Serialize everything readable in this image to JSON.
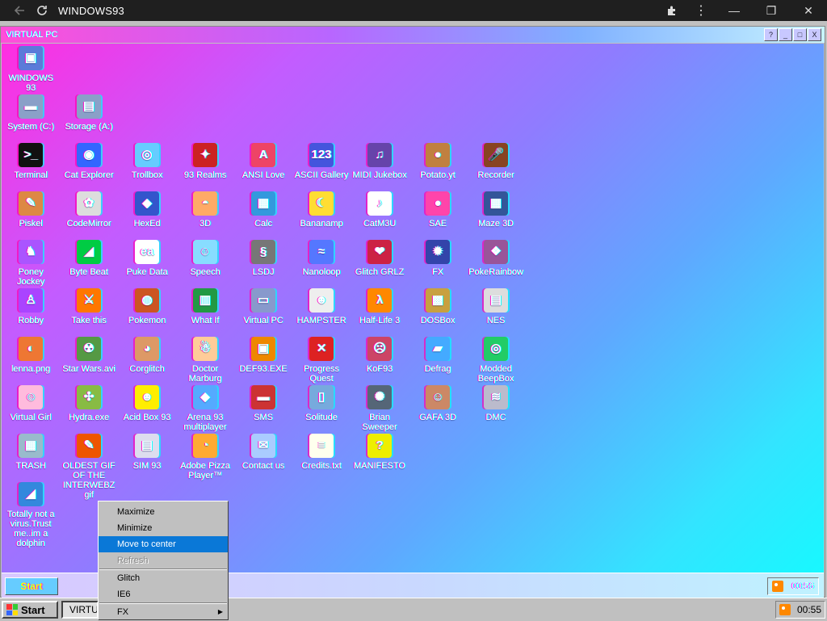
{
  "browser": {
    "title": "WINDOWS93",
    "icons": [
      "back-arrow-icon",
      "reload-icon",
      "extensions-icon",
      "menu-dots-icon",
      "minimize-icon",
      "restore-icon",
      "close-icon"
    ]
  },
  "vpc": {
    "title": "VIRTUAL PC",
    "controls": [
      "?",
      "_",
      "□",
      "X"
    ]
  },
  "desktop": {
    "icons": [
      {
        "label": "WINDOWS 93",
        "color": "#5b7bd9",
        "glyph": "▣"
      },
      {
        "label": "System (C:)",
        "color": "#8aa0c8",
        "glyph": "▬"
      },
      {
        "label": "Storage (A:)",
        "color": "#8aa0c8",
        "glyph": "▤"
      },
      {
        "label": "Terminal",
        "color": "#111111",
        "glyph": ">_"
      },
      {
        "label": "Cat Explorer",
        "color": "#3366ff",
        "glyph": "◉"
      },
      {
        "label": "Trollbox",
        "color": "#66ccff",
        "glyph": "◎"
      },
      {
        "label": "93 Realms",
        "color": "#cc2222",
        "glyph": "✦"
      },
      {
        "label": "ANSI Love",
        "color": "#ee4466",
        "glyph": "A"
      },
      {
        "label": "ASCII Gallery",
        "color": "#4455dd",
        "glyph": "123"
      },
      {
        "label": "MIDI Jukebox",
        "color": "#6644aa",
        "glyph": "♫"
      },
      {
        "label": "Potato.yt",
        "color": "#c08040",
        "glyph": "●"
      },
      {
        "label": "Recorder",
        "color": "#884422",
        "glyph": "🎤"
      },
      {
        "label": "Piskel",
        "color": "#dd8844",
        "glyph": "✎"
      },
      {
        "label": "CodeMirror",
        "color": "#dddddd",
        "glyph": "✿"
      },
      {
        "label": "HexEd",
        "color": "#3355cc",
        "glyph": "◆"
      },
      {
        "label": "3D",
        "color": "#ffaa66",
        "glyph": "◓"
      },
      {
        "label": "Calc",
        "color": "#3399dd",
        "glyph": "▦"
      },
      {
        "label": "Bananamp",
        "color": "#ffdd33",
        "glyph": "☾"
      },
      {
        "label": "CatM3U",
        "color": "#ffffff",
        "glyph": "♪"
      },
      {
        "label": "SAE",
        "color": "#ff44aa",
        "glyph": "●"
      },
      {
        "label": "Maze 3D",
        "color": "#335599",
        "glyph": "▦"
      },
      {
        "label": "Poney Jockey",
        "color": "#aa55ff",
        "glyph": "♞"
      },
      {
        "label": "Byte Beat",
        "color": "#00cc44",
        "glyph": "◢"
      },
      {
        "label": "Puke Data",
        "color": "#ffffff",
        "glyph": "ea"
      },
      {
        "label": "Speech",
        "color": "#88ddff",
        "glyph": "☺"
      },
      {
        "label": "LSDJ",
        "color": "#777777",
        "glyph": "§"
      },
      {
        "label": "Nanoloop",
        "color": "#5577ff",
        "glyph": "≈"
      },
      {
        "label": "Glitch GRLZ",
        "color": "#cc2244",
        "glyph": "❤"
      },
      {
        "label": "FX",
        "color": "#3344aa",
        "glyph": "✹"
      },
      {
        "label": "PokeRainbow",
        "color": "#995599",
        "glyph": "❖"
      },
      {
        "label": "Robby",
        "color": "#aa44ff",
        "glyph": "♙"
      },
      {
        "label": "Take this",
        "color": "#ff7700",
        "glyph": "⚔"
      },
      {
        "label": "Pokemon",
        "color": "#cc5522",
        "glyph": "◍"
      },
      {
        "label": "What If",
        "color": "#229944",
        "glyph": "▥"
      },
      {
        "label": "Virtual PC",
        "color": "#8899cc",
        "glyph": "▭"
      },
      {
        "label": "HAMPSTER",
        "color": "#eeeeee",
        "glyph": "☻"
      },
      {
        "label": "Half-Life 3",
        "color": "#ff8800",
        "glyph": "λ"
      },
      {
        "label": "DOSBox",
        "color": "#c8a040",
        "glyph": "▩"
      },
      {
        "label": "NES",
        "color": "#dddddd",
        "glyph": "▤"
      },
      {
        "label": "lenna.png",
        "color": "#ee7733",
        "glyph": "◐"
      },
      {
        "label": "Star Wars.avi",
        "color": "#559944",
        "glyph": "☢"
      },
      {
        "label": "Corglitch",
        "color": "#dd9966",
        "glyph": "◕"
      },
      {
        "label": "Doctor Marburg",
        "color": "#ffcc99",
        "glyph": "☃"
      },
      {
        "label": "DEF93.EXE",
        "color": "#ee8800",
        "glyph": "▣"
      },
      {
        "label": "Progress Quest",
        "color": "#dd2222",
        "glyph": "✕"
      },
      {
        "label": "KoF93",
        "color": "#cc4466",
        "glyph": "☹"
      },
      {
        "label": "Defrag",
        "color": "#44aaff",
        "glyph": "▰"
      },
      {
        "label": "Modded BeepBox",
        "color": "#22cc66",
        "glyph": "◎"
      },
      {
        "label": "Virtual Girl",
        "color": "#ffbbdd",
        "glyph": "☺"
      },
      {
        "label": "Hydra.exe",
        "color": "#88bb44",
        "glyph": "✣"
      },
      {
        "label": "Acid Box 93",
        "color": "#ffee00",
        "glyph": "☻"
      },
      {
        "label": "Arena 93 multiplayer",
        "color": "#55aaff",
        "glyph": "◆"
      },
      {
        "label": "SMS",
        "color": "#cc3333",
        "glyph": "▬"
      },
      {
        "label": "Solitude",
        "color": "#77aadd",
        "glyph": "▯"
      },
      {
        "label": "Brian Sweeper",
        "color": "#556677",
        "glyph": "✺"
      },
      {
        "label": "GAFA 3D",
        "color": "#cc8866",
        "glyph": "☺"
      },
      {
        "label": "DMC",
        "color": "#bbbbcc",
        "glyph": "≋"
      },
      {
        "label": "TRASH",
        "color": "#99bbcc",
        "glyph": "▦"
      },
      {
        "label": "OLDEST GIF OF THE INTERWEBZ gif",
        "color": "#ee5500",
        "glyph": "✎"
      },
      {
        "label": "SIM 93",
        "color": "#ddddee",
        "glyph": "▤"
      },
      {
        "label": "Adobe Pizza Player™",
        "color": "#ffaa33",
        "glyph": "◔"
      },
      {
        "label": "Contact us",
        "color": "#aaccff",
        "glyph": "✉"
      },
      {
        "label": "Credits.txt",
        "color": "#ffffee",
        "glyph": "≡"
      },
      {
        "label": "MANIFESTO",
        "color": "#eeee00",
        "glyph": "?"
      },
      {
        "label": "Totally not a virus.Trust me..im a dolphin",
        "color": "#3388dd",
        "glyph": "◢"
      }
    ]
  },
  "inner_taskbar": {
    "start_label": "Start",
    "clock": "00:56"
  },
  "taskbar": {
    "start_label": "Start",
    "task_label": "VIRTUAL PC",
    "clock": "00:55"
  },
  "context_menu": {
    "items": [
      {
        "label": "Maximize",
        "state": "normal"
      },
      {
        "label": "Minimize",
        "state": "normal"
      },
      {
        "label": "Move to center",
        "state": "selected"
      },
      {
        "label": "Refresh",
        "state": "disabled"
      },
      {
        "label": "Glitch",
        "state": "normal"
      },
      {
        "label": "IE6",
        "state": "normal"
      },
      {
        "label": "FX",
        "state": "submenu"
      }
    ]
  }
}
